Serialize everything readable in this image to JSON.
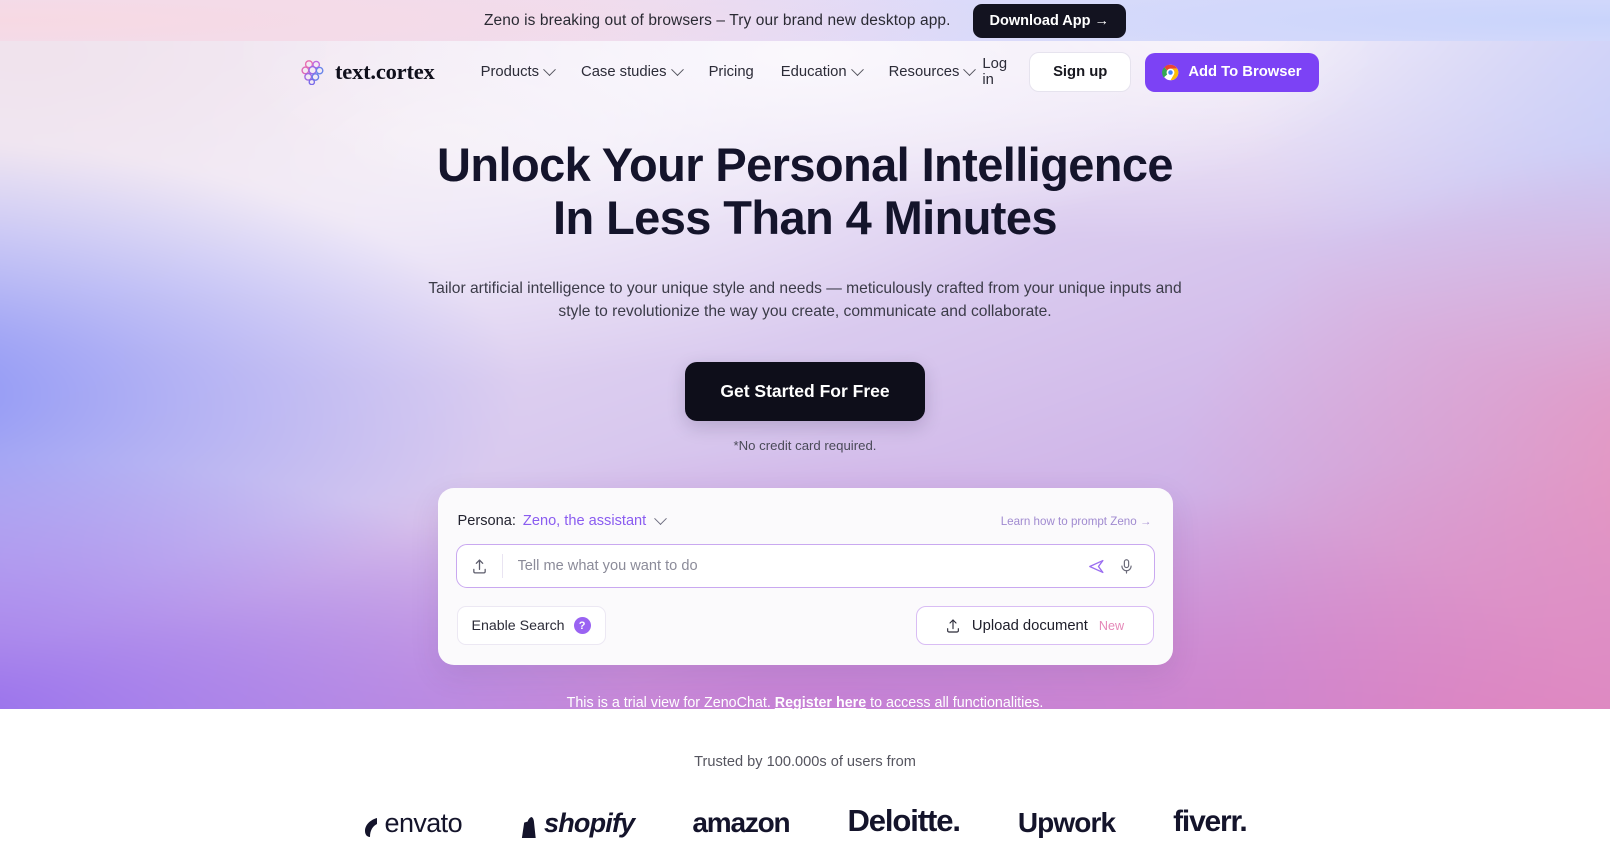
{
  "banner": {
    "message": "Zeno is breaking out of browsers – Try our brand new desktop app.",
    "cta_label": "Download App →"
  },
  "nav": {
    "logo_text": "text.cortex",
    "logo_icon": "flower-cluster-icon",
    "links": [
      {
        "label": "Products",
        "has_dropdown": true
      },
      {
        "label": "Case studies",
        "has_dropdown": true
      },
      {
        "label": "Pricing",
        "has_dropdown": false
      },
      {
        "label": "Education",
        "has_dropdown": true
      },
      {
        "label": "Resources",
        "has_dropdown": true
      }
    ],
    "login_label": "Log in",
    "signup_label": "Sign up",
    "add_browser_label": "Add To Browser",
    "add_browser_icon": "chrome-icon"
  },
  "hero": {
    "title_line1": "Unlock Your Personal Intelligence",
    "title_line2": "In Less Than 4 Minutes",
    "subtitle": "Tailor artificial intelligence to your unique style and needs — meticulously crafted from your unique inputs and style to revolutionize the way you create, communicate and collaborate.",
    "cta_label": "Get Started For Free",
    "note": "*No credit card required."
  },
  "chat": {
    "persona_label": "Persona:",
    "persona_value": "Zeno, the assistant",
    "prompt_link": "Learn how to prompt Zeno →",
    "input_placeholder": "Tell me what you want to do",
    "input_value": "",
    "upload_icon": "upload-icon",
    "send_icon": "send-icon",
    "mic_icon": "microphone-icon",
    "enable_search_label": "Enable Search",
    "help_badge": "?",
    "upload_document_label": "Upload document",
    "upload_document_tag": "New"
  },
  "trial": {
    "prefix": "This is a trial view for ZenoChat.",
    "link": "Register here",
    "suffix": "to access all functionalities."
  },
  "brands": {
    "title": "Trusted by 100.000s of users from",
    "items": [
      {
        "name": "envato"
      },
      {
        "name": "shopify"
      },
      {
        "name": "amazon"
      },
      {
        "name": "Deloitte."
      },
      {
        "name": "Upwork"
      },
      {
        "name": "fiverr."
      }
    ]
  },
  "colors": {
    "accent_purple": "#7c42f5",
    "persona_purple": "#8a5cf0",
    "dark": "#0e0e1a",
    "new_pink": "#e588b8"
  }
}
